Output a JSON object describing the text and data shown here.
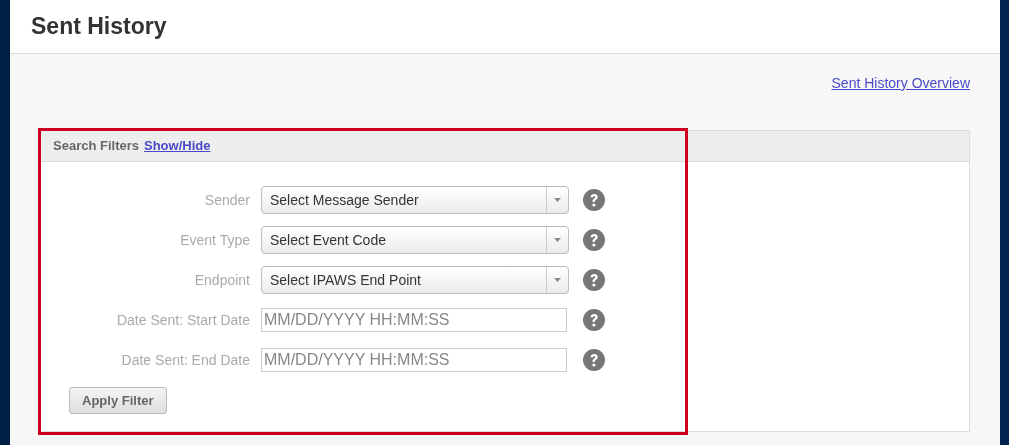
{
  "page_title": "Sent History",
  "overview_link": "Sent History Overview",
  "filters": {
    "title": "Search Filters",
    "toggle_link": "Show/Hide",
    "fields": [
      {
        "label": "Sender",
        "kind": "select",
        "value": "Select Message Sender"
      },
      {
        "label": "Event Type",
        "kind": "select",
        "value": "Select Event Code"
      },
      {
        "label": "Endpoint",
        "kind": "select",
        "value": "Select IPAWS End Point"
      },
      {
        "label": "Date Sent: Start Date",
        "kind": "date",
        "placeholder": "MM/DD/YYYY HH:MM:SS"
      },
      {
        "label": "Date Sent: End Date",
        "kind": "date",
        "placeholder": "MM/DD/YYYY HH:MM:SS"
      }
    ],
    "apply_button": "Apply Filter"
  }
}
